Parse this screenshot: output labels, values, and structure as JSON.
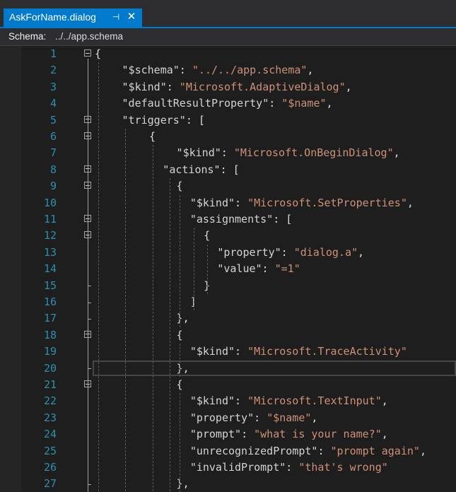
{
  "tab": {
    "title": "AskForName.dialog",
    "pin_icon": "pin-icon",
    "close_icon": "close-icon"
  },
  "schema_bar": {
    "label": "Schema:",
    "value": "../../app.schema"
  },
  "colors": {
    "accent": "#007acc",
    "editor_bg": "#1e1e1e",
    "line_number": "#2b91af",
    "string": "#ce9178",
    "text": "#dcdcdc"
  },
  "editor": {
    "current_line": 20,
    "lines": [
      {
        "n": "1",
        "fold": true,
        "indent": 0,
        "tokens": [
          {
            "t": "{",
            "c": "punc"
          }
        ]
      },
      {
        "n": "2",
        "fold": false,
        "indent": 4,
        "tokens": [
          {
            "t": "\"$schema\"",
            "c": "key"
          },
          {
            "t": ": ",
            "c": "punc"
          },
          {
            "t": "\"../../app.schema\"",
            "c": "str"
          },
          {
            "t": ",",
            "c": "punc"
          }
        ]
      },
      {
        "n": "3",
        "fold": false,
        "indent": 4,
        "tokens": [
          {
            "t": "\"$kind\"",
            "c": "key"
          },
          {
            "t": ": ",
            "c": "punc"
          },
          {
            "t": "\"Microsoft.AdaptiveDialog\"",
            "c": "str"
          },
          {
            "t": ",",
            "c": "punc"
          }
        ]
      },
      {
        "n": "4",
        "fold": false,
        "indent": 4,
        "tokens": [
          {
            "t": "\"defaultResultProperty\"",
            "c": "key"
          },
          {
            "t": ": ",
            "c": "punc"
          },
          {
            "t": "\"$name\"",
            "c": "str"
          },
          {
            "t": ",",
            "c": "punc"
          }
        ]
      },
      {
        "n": "5",
        "fold": true,
        "indent": 4,
        "tokens": [
          {
            "t": "\"triggers\"",
            "c": "key"
          },
          {
            "t": ": [",
            "c": "punc"
          }
        ]
      },
      {
        "n": "6",
        "fold": true,
        "indent": 8,
        "tokens": [
          {
            "t": "{",
            "c": "punc"
          }
        ]
      },
      {
        "n": "7",
        "fold": false,
        "indent": 12,
        "tokens": [
          {
            "t": "\"$kind\"",
            "c": "key"
          },
          {
            "t": ": ",
            "c": "punc"
          },
          {
            "t": "\"Microsoft.OnBeginDialog\"",
            "c": "str"
          },
          {
            "t": ",",
            "c": "punc"
          }
        ]
      },
      {
        "n": "8",
        "fold": true,
        "indent": 10,
        "tokens": [
          {
            "t": "\"actions\"",
            "c": "key"
          },
          {
            "t": ": [",
            "c": "punc"
          }
        ]
      },
      {
        "n": "9",
        "fold": true,
        "indent": 12,
        "tokens": [
          {
            "t": "{",
            "c": "punc"
          }
        ]
      },
      {
        "n": "10",
        "fold": false,
        "indent": 14,
        "tokens": [
          {
            "t": "\"$kind\"",
            "c": "key"
          },
          {
            "t": ": ",
            "c": "punc"
          },
          {
            "t": "\"Microsoft.SetProperties\"",
            "c": "str"
          },
          {
            "t": ",",
            "c": "punc"
          }
        ]
      },
      {
        "n": "11",
        "fold": true,
        "indent": 14,
        "tokens": [
          {
            "t": "\"assignments\"",
            "c": "key"
          },
          {
            "t": ": [",
            "c": "punc"
          }
        ]
      },
      {
        "n": "12",
        "fold": true,
        "indent": 16,
        "tokens": [
          {
            "t": "{",
            "c": "punc"
          }
        ]
      },
      {
        "n": "13",
        "fold": false,
        "indent": 18,
        "tokens": [
          {
            "t": "\"property\"",
            "c": "key"
          },
          {
            "t": ": ",
            "c": "punc"
          },
          {
            "t": "\"dialog.a\"",
            "c": "str"
          },
          {
            "t": ",",
            "c": "punc"
          }
        ]
      },
      {
        "n": "14",
        "fold": false,
        "indent": 18,
        "tokens": [
          {
            "t": "\"value\"",
            "c": "key"
          },
          {
            "t": ": ",
            "c": "punc"
          },
          {
            "t": "\"=1\"",
            "c": "str"
          }
        ]
      },
      {
        "n": "15",
        "fold": false,
        "indent": 16,
        "tokens": [
          {
            "t": "}",
            "c": "punc"
          }
        ]
      },
      {
        "n": "16",
        "fold": false,
        "indent": 14,
        "tokens": [
          {
            "t": "]",
            "c": "punc"
          }
        ]
      },
      {
        "n": "17",
        "fold": false,
        "indent": 12,
        "tokens": [
          {
            "t": "},",
            "c": "punc"
          }
        ]
      },
      {
        "n": "18",
        "fold": true,
        "indent": 12,
        "tokens": [
          {
            "t": "{",
            "c": "punc"
          }
        ]
      },
      {
        "n": "19",
        "fold": false,
        "indent": 14,
        "tokens": [
          {
            "t": "\"$kind\"",
            "c": "key"
          },
          {
            "t": ": ",
            "c": "punc"
          },
          {
            "t": "\"Microsoft.TraceActivity\"",
            "c": "str"
          }
        ]
      },
      {
        "n": "20",
        "fold": false,
        "indent": 12,
        "tokens": [
          {
            "t": "},",
            "c": "punc"
          }
        ]
      },
      {
        "n": "21",
        "fold": true,
        "indent": 12,
        "tokens": [
          {
            "t": "{",
            "c": "punc"
          }
        ]
      },
      {
        "n": "22",
        "fold": false,
        "indent": 14,
        "tokens": [
          {
            "t": "\"$kind\"",
            "c": "key"
          },
          {
            "t": ": ",
            "c": "punc"
          },
          {
            "t": "\"Microsoft.TextInput\"",
            "c": "str"
          },
          {
            "t": ",",
            "c": "punc"
          }
        ]
      },
      {
        "n": "23",
        "fold": false,
        "indent": 14,
        "tokens": [
          {
            "t": "\"property\"",
            "c": "key"
          },
          {
            "t": ": ",
            "c": "punc"
          },
          {
            "t": "\"$name\"",
            "c": "str"
          },
          {
            "t": ",",
            "c": "punc"
          }
        ]
      },
      {
        "n": "24",
        "fold": false,
        "indent": 14,
        "tokens": [
          {
            "t": "\"prompt\"",
            "c": "key"
          },
          {
            "t": ": ",
            "c": "punc"
          },
          {
            "t": "\"what is your name?\"",
            "c": "str"
          },
          {
            "t": ",",
            "c": "punc"
          }
        ]
      },
      {
        "n": "25",
        "fold": false,
        "indent": 14,
        "tokens": [
          {
            "t": "\"unrecognizedPrompt\"",
            "c": "key"
          },
          {
            "t": ": ",
            "c": "punc"
          },
          {
            "t": "\"prompt again\"",
            "c": "str"
          },
          {
            "t": ",",
            "c": "punc"
          }
        ]
      },
      {
        "n": "26",
        "fold": false,
        "indent": 14,
        "tokens": [
          {
            "t": "\"invalidPrompt\"",
            "c": "key"
          },
          {
            "t": ": ",
            "c": "punc"
          },
          {
            "t": "\"that's wrong\"",
            "c": "str"
          }
        ]
      },
      {
        "n": "27",
        "fold": false,
        "indent": 12,
        "tokens": [
          {
            "t": "},",
            "c": "punc"
          }
        ]
      }
    ]
  }
}
